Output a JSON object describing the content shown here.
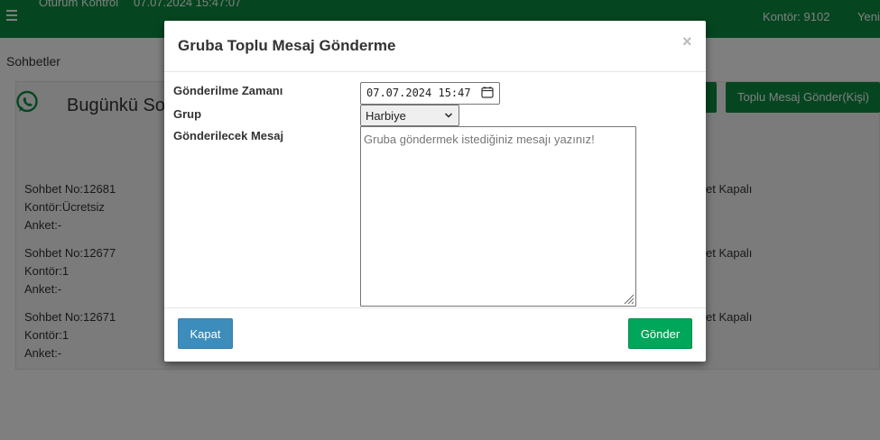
{
  "topbar": {
    "title": "Oturum Kontrol",
    "timestamp": "07.07.2024 15:47:07",
    "kontor": "Kontör: 9102",
    "yeni": "Yeni"
  },
  "breadcrumb": "Sohbetler",
  "card": {
    "title": "Bugünkü Sohbetler",
    "toplu_button": "Toplu Mesaj Gönder(Kişi)"
  },
  "chats": [
    {
      "no": "Sohbet No:12681",
      "kontor": "Kontör:Ücretsiz",
      "anket": "Anket:-",
      "status": "et Kapalı"
    },
    {
      "no": "Sohbet No:12677",
      "kontor": "Kontör:1",
      "anket": "Anket:-",
      "status": "et Kapalı"
    },
    {
      "no": "Sohbet No:12671",
      "kontor": "Kontör:1",
      "anket": "Anket:-",
      "status": "et Kapalı"
    }
  ],
  "modal": {
    "title": "Gruba Toplu Mesaj Gönderme",
    "close": "×",
    "time_label": "Gönderilme Zamanı",
    "time_value": "07.07.2024 15:47",
    "group_label": "Grup",
    "group_value": "Harbiye",
    "message_label": "Gönderilecek Mesaj",
    "message_placeholder": "Gruba göndermek istediğiniz mesajı yazınız!",
    "cancel_label": "Kapat",
    "send_label": "Gönder"
  },
  "colors": {
    "brand_green": "#0b8d40",
    "primary_blue": "#3c8dbc",
    "success_green": "#00a65a"
  }
}
